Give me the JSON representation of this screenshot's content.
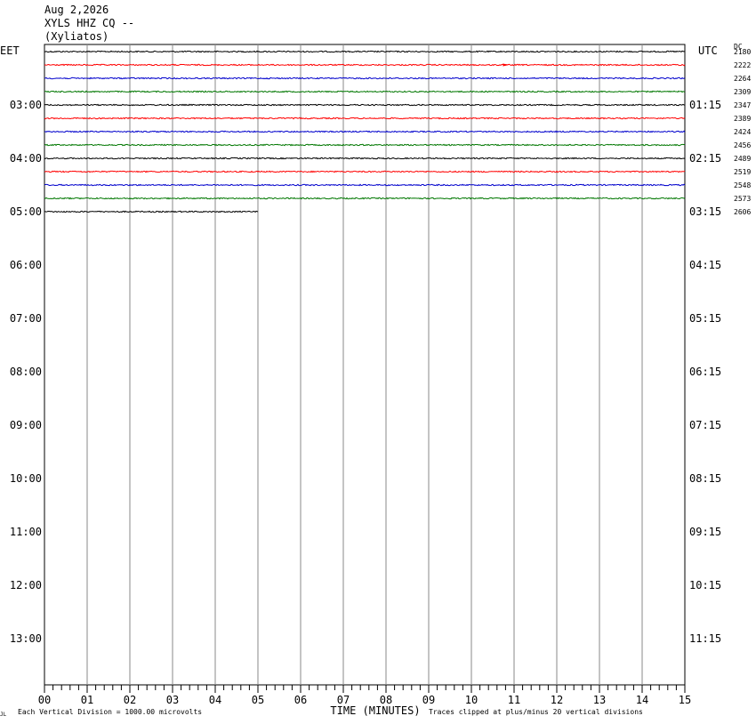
{
  "header": {
    "date": "Aug 2,2026",
    "station": "XYLS HHZ CQ --",
    "location": "(Xyliatos)"
  },
  "left_timezone": "EET",
  "right_timezone": "UTC",
  "dc_label": "DC",
  "footer": {
    "corner_mark": "JL",
    "vertical_division": "Each Vertical Division = 1000.00 microvolts",
    "xlabel": "TIME (MINUTES)",
    "clip_note": "Traces clipped at plus/minus 20 vertical divisions"
  },
  "chart_data": {
    "type": "line",
    "xlabel": "TIME (MINUTES)",
    "xlim": [
      0,
      15
    ],
    "x_ticks": [
      "00",
      "01",
      "02",
      "03",
      "04",
      "05",
      "06",
      "07",
      "08",
      "09",
      "10",
      "11",
      "12",
      "13",
      "14",
      "15"
    ],
    "rows_per_hour": 4,
    "left_hour_labels": [
      "03:00",
      "04:00",
      "05:00",
      "06:00",
      "07:00",
      "08:00",
      "09:00",
      "10:00",
      "11:00",
      "12:00",
      "13:00"
    ],
    "right_hour_labels": [
      "01:15",
      "02:15",
      "03:15",
      "04:15",
      "05:15",
      "06:15",
      "07:15",
      "08:15",
      "09:15",
      "10:15",
      "11:15"
    ],
    "trace_colors": [
      "#000000",
      "#ff0000",
      "#0000cc",
      "#007700"
    ],
    "traces": [
      {
        "row": 0,
        "dc": "2180",
        "end_minute": 15
      },
      {
        "row": 1,
        "dc": "2222",
        "end_minute": 15
      },
      {
        "row": 2,
        "dc": "2264",
        "end_minute": 15
      },
      {
        "row": 3,
        "dc": "2309",
        "end_minute": 15
      },
      {
        "row": 4,
        "dc": "2347",
        "end_minute": 15
      },
      {
        "row": 5,
        "dc": "2389",
        "end_minute": 15
      },
      {
        "row": 6,
        "dc": "2424",
        "end_minute": 15
      },
      {
        "row": 7,
        "dc": "2456",
        "end_minute": 15
      },
      {
        "row": 8,
        "dc": "2489",
        "end_minute": 15
      },
      {
        "row": 9,
        "dc": "2519",
        "end_minute": 15
      },
      {
        "row": 10,
        "dc": "2548",
        "end_minute": 15
      },
      {
        "row": 11,
        "dc": "2573",
        "end_minute": 15
      },
      {
        "row": 12,
        "dc": "2606",
        "end_minute": 5
      }
    ]
  }
}
